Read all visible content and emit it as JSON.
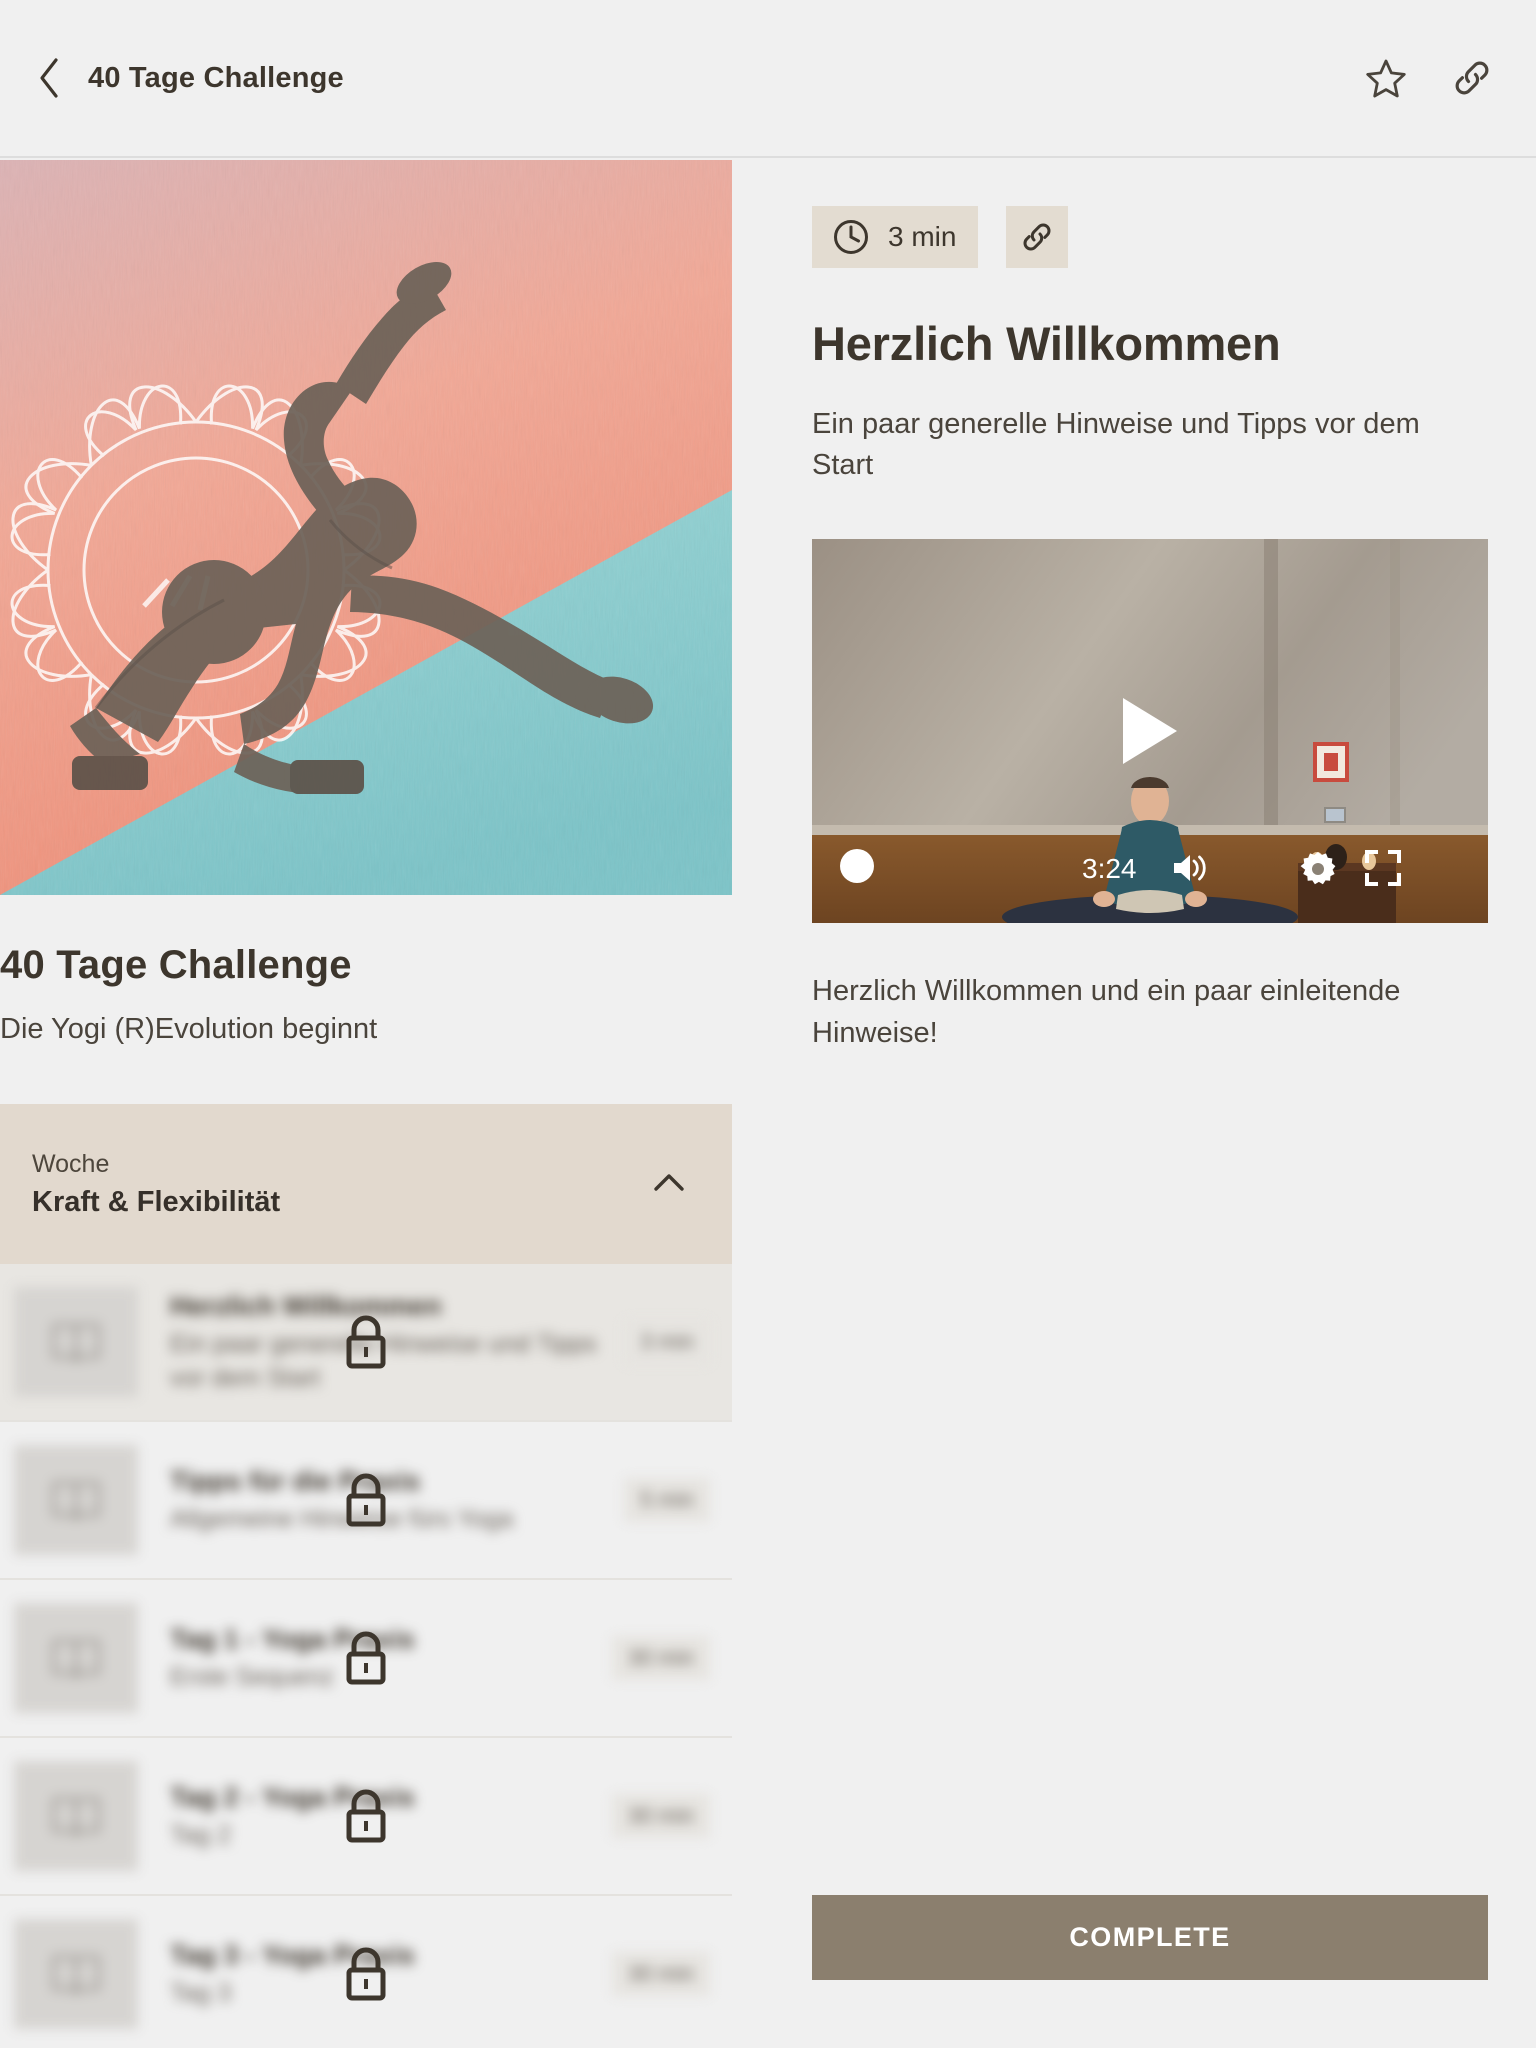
{
  "header": {
    "title": "40 Tage Challenge",
    "back_icon": "chevron-left-icon",
    "favorite_icon": "star-icon",
    "share_icon": "link-icon"
  },
  "course": {
    "title": "40 Tage Challenge",
    "subtitle": "Die Yogi (R)Evolution beginnt",
    "hero_image_alt": "yoga-pose-hero"
  },
  "section": {
    "kicker": "Woche",
    "title": "Kraft & Flexibilität",
    "collapse_icon": "chevron-up-icon"
  },
  "lessons": [
    {
      "title": "Herzlich Willkommen",
      "subtitle": "Ein paar generelle Hinweise und Tipps vor dem Start",
      "duration": "3 min",
      "locked": true,
      "active": true
    },
    {
      "title": "Tipps für die Praxis",
      "subtitle": "Allgemeine Hinweise fürs Yoga",
      "duration": "5 min",
      "locked": true,
      "active": false
    },
    {
      "title": "Tag 1 - Yoga Praxis",
      "subtitle": "Erste Sequenz",
      "duration": "30 min",
      "locked": true,
      "active": false
    },
    {
      "title": "Tag 2 - Yoga Praxis",
      "subtitle": "Tag 2",
      "duration": "30 min",
      "locked": true,
      "active": false
    },
    {
      "title": "Tag 3 - Yoga Praxis",
      "subtitle": "Tag 3",
      "duration": "30 min",
      "locked": true,
      "active": false
    }
  ],
  "detail": {
    "duration_badge": "3 min",
    "clock_icon": "clock-icon",
    "link_icon": "link-icon",
    "heading": "Herzlich Willkommen",
    "description": "Ein paar generelle Hinweise und Tipps vor dem Start",
    "video_caption": "Herzlich Willkommen und ein paar einleitende Hinweise!"
  },
  "player": {
    "time_remaining": "3:24",
    "play_icon": "play-icon",
    "volume_icon": "volume-icon",
    "settings_icon": "gear-icon",
    "fullscreen_icon": "fullscreen-icon",
    "scrubber_position": "0%"
  },
  "actions": {
    "complete_label": "COMPLETE"
  },
  "colors": {
    "page_background": "#f0f0f0",
    "text_primary": "#3d362d",
    "text_secondary": "#4a443c",
    "badge_background": "#e3dcd1",
    "accordion_background": "#e2d9ce",
    "button_background": "#8b7f6e",
    "hero_coral": "#f0a99b",
    "hero_teal": "#8cd2d4"
  }
}
